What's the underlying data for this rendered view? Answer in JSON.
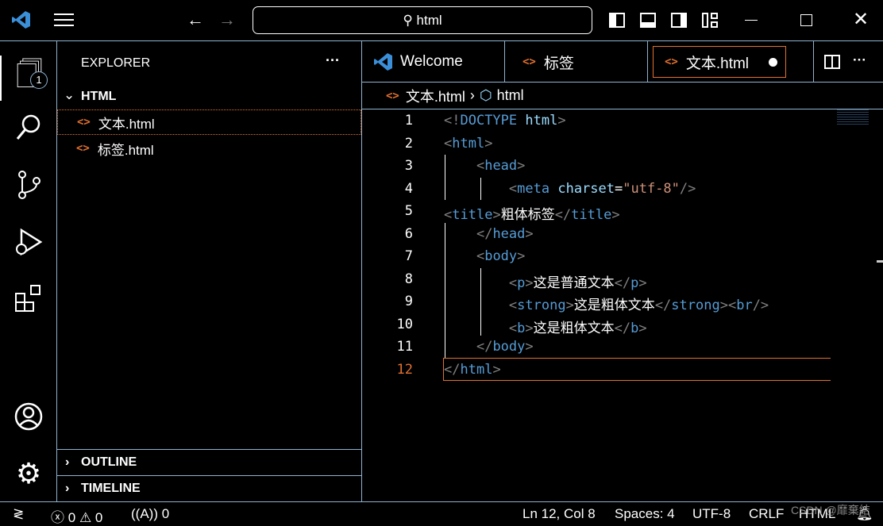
{
  "titlebar": {
    "search": "html",
    "nav_back": "←",
    "nav_forward": "→"
  },
  "activity": {
    "explorer_badge": "1"
  },
  "sidebar": {
    "title": "EXPLORER",
    "more": "···",
    "folder": "HTML",
    "files": [
      "文本.html",
      "标签.html"
    ],
    "outline": "OUTLINE",
    "timeline": "TIMELINE"
  },
  "tabs": [
    {
      "label": "Welcome"
    },
    {
      "label": "标签"
    },
    {
      "label": "文本.html",
      "dirty": true,
      "active": true
    }
  ],
  "breadcrumb": {
    "file": "文本.html",
    "symbol": "html",
    "sep": "›"
  },
  "code": {
    "line_numbers": [
      "1",
      "2",
      "3",
      "4",
      "5",
      "6",
      "7",
      "8",
      "9",
      "10",
      "11",
      "12"
    ],
    "current_line": 12
  },
  "status": {
    "errors": "0",
    "warnings": "0",
    "ports": "0",
    "position": "Ln 12, Col 8",
    "spaces": "Spaces: 4",
    "encoding": "UTF-8",
    "eol": "CRLF",
    "language": "HTML",
    "watermark": "CSDN @靡棄結"
  },
  "colors": {
    "border": "#8fb3d1",
    "tag": "#569cd6",
    "attr": "#9cdcfe",
    "string": "#ce9178",
    "active_line": "#e2712f"
  }
}
